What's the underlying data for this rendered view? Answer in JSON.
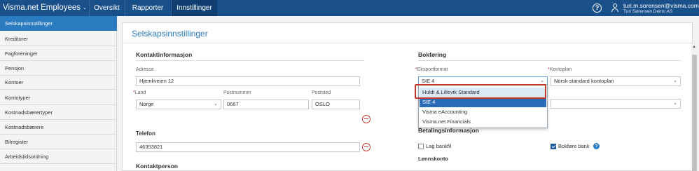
{
  "app": {
    "name": "Visma.net Employees",
    "tabs": [
      {
        "label": "Oversikt"
      },
      {
        "label": "Rapporter"
      },
      {
        "label": "Innstillinger"
      }
    ],
    "user": {
      "email": "turi.m.sorensen@visma.com",
      "company": "Turi Sørensen Demo AS"
    }
  },
  "sidebar": {
    "items": [
      {
        "label": "Selskapsinnstillinger"
      },
      {
        "label": "Kreditorer"
      },
      {
        "label": "Fagforeninger"
      },
      {
        "label": "Pensjon"
      },
      {
        "label": "Kontoer"
      },
      {
        "label": "Kontotyper"
      },
      {
        "label": "Kostnadsbærertyper"
      },
      {
        "label": "Kostnadsbærere"
      },
      {
        "label": "Bilregister"
      },
      {
        "label": "Arbeidstidsordning"
      }
    ]
  },
  "page": {
    "title": "Selskapsinnstillinger"
  },
  "contact": {
    "heading": "Kontaktinformasjon",
    "address_label": "Adresse",
    "address_value": "Hjemliveien 12",
    "country_label": "Land",
    "country_value": "Norge",
    "postal_label": "Postnummer",
    "postal_value": "0667",
    "city_label": "Poststed",
    "city_value": "OSLO",
    "phone_heading": "Telefon",
    "phone_value": "46353821",
    "person_heading": "Kontaktperson"
  },
  "accounting": {
    "heading": "Bokføring",
    "export_label": "Eksportformat",
    "export_value": "SIE 4",
    "chart_label": "Kontoplan",
    "chart_value": "Norsk standard kontoplan",
    "export_options": [
      {
        "label": "Huldt & Lillevik Standard"
      },
      {
        "label": "SIE 4"
      },
      {
        "label": "Visma eAccounting"
      },
      {
        "label": "Visma.net Financials"
      }
    ]
  },
  "payment": {
    "heading": "Betalingsinformasjon",
    "bankfile_label": "Lag bankfil",
    "bankfile_checked": false,
    "book_bank_label": "Bokføre bank",
    "book_bank_checked": true,
    "payroll_account_heading": "Lønnskonto"
  },
  "colors": {
    "topbar": "#1a5089",
    "accent": "#2b7bc0",
    "danger": "#d0403a"
  }
}
